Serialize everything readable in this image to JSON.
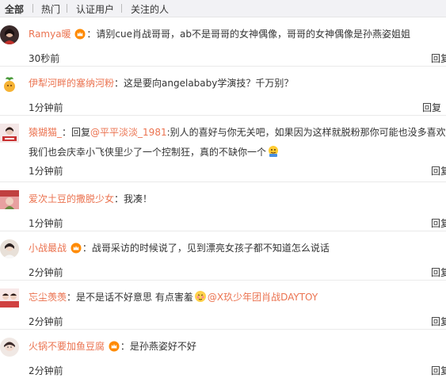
{
  "tabs": [
    "全部",
    "热门",
    "认证用户",
    "关注的人"
  ],
  "reply_label": "回复",
  "comments": [
    {
      "user": "Ramya暖",
      "sep": "：",
      "text": "请别cue肖战哥哥，ab不是哥哥的女神偶像，哥哥的女神偶像是孙燕姿姐姐",
      "time": "30秒前"
    },
    {
      "user": "伊犁河畔的塞纳河粉",
      "sep": "：",
      "text": "这是要向angelababy学演技？千万别？",
      "time": "1分钟前"
    },
    {
      "user": "猿猢猫_",
      "sep": "：",
      "reply_prefix": "回复",
      "mention": "@平平淡淡_1981",
      "text": ":别人的喜好与你无关吧，如果因为这样就脱粉那你可能也没多喜欢",
      "line2": "我们也会庆幸小飞侠里少了一个控制狂，真的不缺你一个",
      "time": "1分钟前"
    },
    {
      "user": "爱次土豆的撒脱少女",
      "sep": "：",
      "text": "我凑！",
      "time": "1分钟前"
    },
    {
      "user": "小战最战",
      "sep": "：",
      "text": "战哥采访的时候说了，见到漂亮女孩子都不知道怎么说话",
      "time": "2分钟前"
    },
    {
      "user": "忘尘羡羡",
      "sep": "：",
      "text": "是不是话不好意思 有点害羞",
      "mention": "@X玖少年团肖战DAYTOY",
      "time": "2分钟前"
    },
    {
      "user": "火锅不要加鱼豆腐",
      "sep": "：",
      "text": "是孙燕姿好不好",
      "time": "2分钟前"
    }
  ],
  "colors": {
    "accent": "#eb7350",
    "tab_bg": "#f2f2f5",
    "border": "#eaeaea"
  }
}
